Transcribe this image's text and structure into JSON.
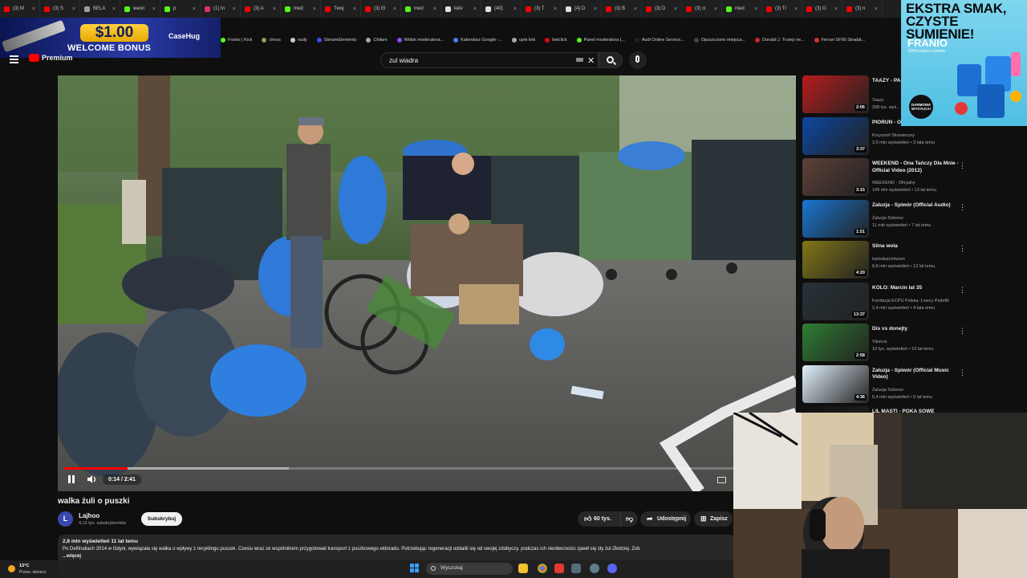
{
  "browser": {
    "tabs": [
      {
        "label": "(3) M",
        "color": "#ff0000"
      },
      {
        "label": "(3) S",
        "color": "#ff0000"
      },
      {
        "label": "BELA",
        "color": "#9e9e9e"
      },
      {
        "label": "weon",
        "color": "#53fc18"
      },
      {
        "label": "p",
        "color": "#53fc18"
      },
      {
        "label": "(1) In",
        "color": "#e1306c"
      },
      {
        "label": "(3) A",
        "color": "#ff0000"
      },
      {
        "label": "med",
        "color": "#53fc18"
      },
      {
        "label": "Twoj",
        "color": "#ff0000"
      },
      {
        "label": "(3) El",
        "color": "#ff0000"
      },
      {
        "label": "med",
        "color": "#53fc18"
      },
      {
        "label": "kelv",
        "color": "#e0e0e0"
      },
      {
        "label": "(40)",
        "color": "#e0e0e0"
      },
      {
        "label": "(3) T",
        "color": "#ff0000"
      },
      {
        "label": "(4) D",
        "color": "#e0e0e0"
      },
      {
        "label": "(3) B",
        "color": "#ff0000"
      },
      {
        "label": "(3) D",
        "color": "#ff0000"
      },
      {
        "label": "(3) ci",
        "color": "#ff0000"
      },
      {
        "label": "med",
        "color": "#53fc18"
      },
      {
        "label": "(3) Tr",
        "color": "#ff0000"
      },
      {
        "label": "(3) O",
        "color": "#ff0000"
      },
      {
        "label": "(3) n",
        "color": "#ff0000"
      }
    ],
    "bookmarks": [
      {
        "label": "Franio | Kick",
        "color": "#53fc18"
      },
      {
        "label": "chess",
        "color": "#7fa650"
      },
      {
        "label": "nudy",
        "color": "#cccccc"
      },
      {
        "label": "StreamElements",
        "color": "#3c4ef0"
      },
      {
        "label": "Chiłam",
        "color": "#aaaaaa"
      },
      {
        "label": "Widok moderatora...",
        "color": "#9146ff"
      },
      {
        "label": "Kalendarz Google -...",
        "color": "#4285f4"
      },
      {
        "label": "ujeb link",
        "color": "#aaaaaa"
      },
      {
        "label": "betclick",
        "color": "#e30613"
      },
      {
        "label": "Panel moderatora |...",
        "color": "#53fc18"
      },
      {
        "label": "Audi Online Service...",
        "color": "#222222"
      },
      {
        "label": "Opuszczone miejsca...",
        "color": "#444444"
      },
      {
        "label": "Donald J. Trump ne...",
        "color": "#c62828"
      },
      {
        "label": "Ferrari SF90 Stradal...",
        "color": "#d32f2f"
      }
    ]
  },
  "casino_ad": {
    "amount": "$1.00",
    "bonus": "WELCOME BONUS",
    "brand": "CaseHug"
  },
  "youtube": {
    "logo_text": "Premium",
    "search_value": "zul wiadra",
    "player": {
      "time": "0:14 / 2:41",
      "progress_fraction": 0.087,
      "buffered_fraction": 0.31
    },
    "video": {
      "title": "walka żuli o puszki",
      "channel_initial": "L",
      "channel_name": "Lajhoo",
      "channel_subs": "4,12 tys. subskrybentów",
      "subscribe_label": "Subskrybuj",
      "likes": "60 tys.",
      "share_label": "Udostępnij",
      "save_label": "Zapisz",
      "stats": "2,8 mln wyświetleń  11 lat temu",
      "description": "Po Delfinaliach 2014 w Gdyni, wywiązała się walka o wpływy z recyklingu puszek. Czesiu wraz ze wspólnikiem przygotowali transport z puszkowego eldorado. Potrzebując regeneracji oddalili się od swojej zdobyczy. podczas ich nieobecności zjawił się zły żul Złodziej. Zob",
      "more_label": "...więcej"
    },
    "recommendations": [
      {
        "title": "TAAZY - PA... CrackHouse",
        "channel": "Taazy",
        "meta": "208 tys. wyś...",
        "duration": "2:06",
        "thumb": "#b71c1c",
        "two_line": true
      },
      {
        "title": "PIORUN - O...",
        "channel": "Krzysztof Skowieczny",
        "meta": "3,6 mln wyświetleń • 3 lata temu",
        "duration": "3:37",
        "thumb": "#0d47a1",
        "two_line": false
      },
      {
        "title": "WEEKEND - Ona Tańczy Dla Mnie - Official Video (2012)",
        "channel": "WEEKEND - Oficjalny",
        "meta": "149 mln wyświetleń • 13 lat temu",
        "duration": "3:15",
        "thumb": "#5d4037",
        "two_line": true
      },
      {
        "title": "Zaluzja - Śpiwór (Official Audio)",
        "channel": "Żaluzja Solonez",
        "meta": "11 mln wyświetleń • 7 lat temu",
        "duration": "1:51",
        "thumb": "#1976d2",
        "two_line": false
      },
      {
        "title": "Silna wola",
        "channel": "tvplodzarchiwum",
        "meta": "8,8 mln wyświetleń • 12 lat temu",
        "duration": "4:20",
        "thumb": "#827717",
        "two_line": false
      },
      {
        "title": "KOLO: Marcin lat 35",
        "channel": "Fundacja ECPU Polska: Łowcy Pedofili",
        "meta": "2,4 mln wyświetleń • 4 lata temu",
        "duration": "13:37",
        "thumb": "#263238",
        "two_line": false
      },
      {
        "title": "Dis vs donejty",
        "channel": "Viperus",
        "meta": "10 tys. wyświetleń • 10 lat temu",
        "duration": "2:58",
        "thumb": "#2e7d32",
        "two_line": false
      },
      {
        "title": "Żaluzja - Śpiwór (Official Music Video)",
        "channel": "Żaluzja Solonez",
        "meta": "5,4 mln wyświetleń • 5 lat temu",
        "duration": "4:36",
        "thumb": "#e3f2fd",
        "two_line": true
      },
      {
        "title": "LIL MASTI - POKA SOWE",
        "channel": "",
        "meta": "",
        "duration": "",
        "thumb": "#111111",
        "two_line": false
      }
    ]
  },
  "franio_ad": {
    "headline_1": "EKSTRA SMAK,",
    "headline_2": "CZYSTE SUMIENIE!",
    "brand": "FRANIO",
    "tagline": "100% zniżki z kodem",
    "badge": "DARMOWA WYSYŁKA!"
  },
  "taskbar": {
    "temperature": "13°C",
    "weather_desc": "Przew. słonecz.",
    "search_placeholder": "Wyszukaj"
  },
  "colors": {
    "yt_red": "#ff0000",
    "bg": "#0f0f0f",
    "chip": "#272727"
  }
}
